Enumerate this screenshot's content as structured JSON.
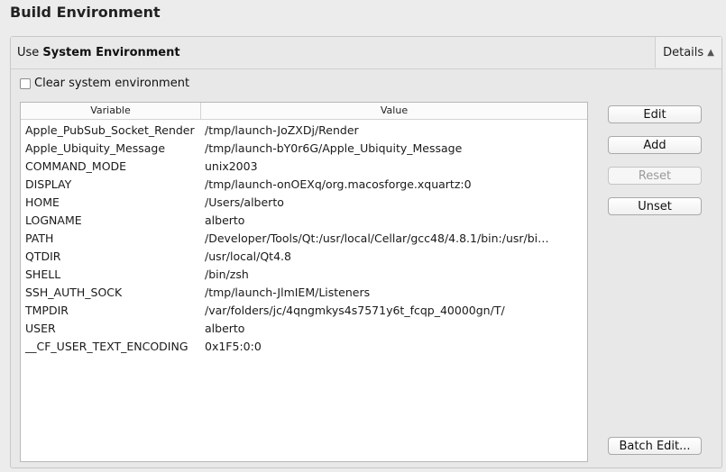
{
  "page_title": "Build Environment",
  "section": {
    "heading_prefix": "Use ",
    "heading_bold": "System Environment",
    "details_label": "Details",
    "details_icon": "triangle-up-icon"
  },
  "clear_checkbox": {
    "label": "Clear system environment",
    "checked": false
  },
  "table": {
    "columns": [
      "Variable",
      "Value"
    ],
    "rows": [
      [
        "Apple_PubSub_Socket_Render",
        "/tmp/launch-JoZXDj/Render"
      ],
      [
        "Apple_Ubiquity_Message",
        "/tmp/launch-bY0r6G/Apple_Ubiquity_Message"
      ],
      [
        "COMMAND_MODE",
        "unix2003"
      ],
      [
        "DISPLAY",
        "/tmp/launch-onOEXq/org.macosforge.xquartz:0"
      ],
      [
        "HOME",
        "/Users/alberto"
      ],
      [
        "LOGNAME",
        "alberto"
      ],
      [
        "PATH",
        "/Developer/Tools/Qt:/usr/local/Cellar/gcc48/4.8.1/bin:/usr/bi…"
      ],
      [
        "QTDIR",
        "/usr/local/Qt4.8"
      ],
      [
        "SHELL",
        "/bin/zsh"
      ],
      [
        "SSH_AUTH_SOCK",
        "/tmp/launch-JlmIEM/Listeners"
      ],
      [
        "TMPDIR",
        "/var/folders/jc/4qngmkys4s7571y6t_fcqp_40000gn/T/"
      ],
      [
        "USER",
        "alberto"
      ],
      [
        "__CF_USER_TEXT_ENCODING",
        "0x1F5:0:0"
      ]
    ]
  },
  "buttons": {
    "edit": "Edit",
    "add": "Add",
    "reset": "Reset",
    "unset": "Unset",
    "batch_edit": "Batch Edit..."
  }
}
